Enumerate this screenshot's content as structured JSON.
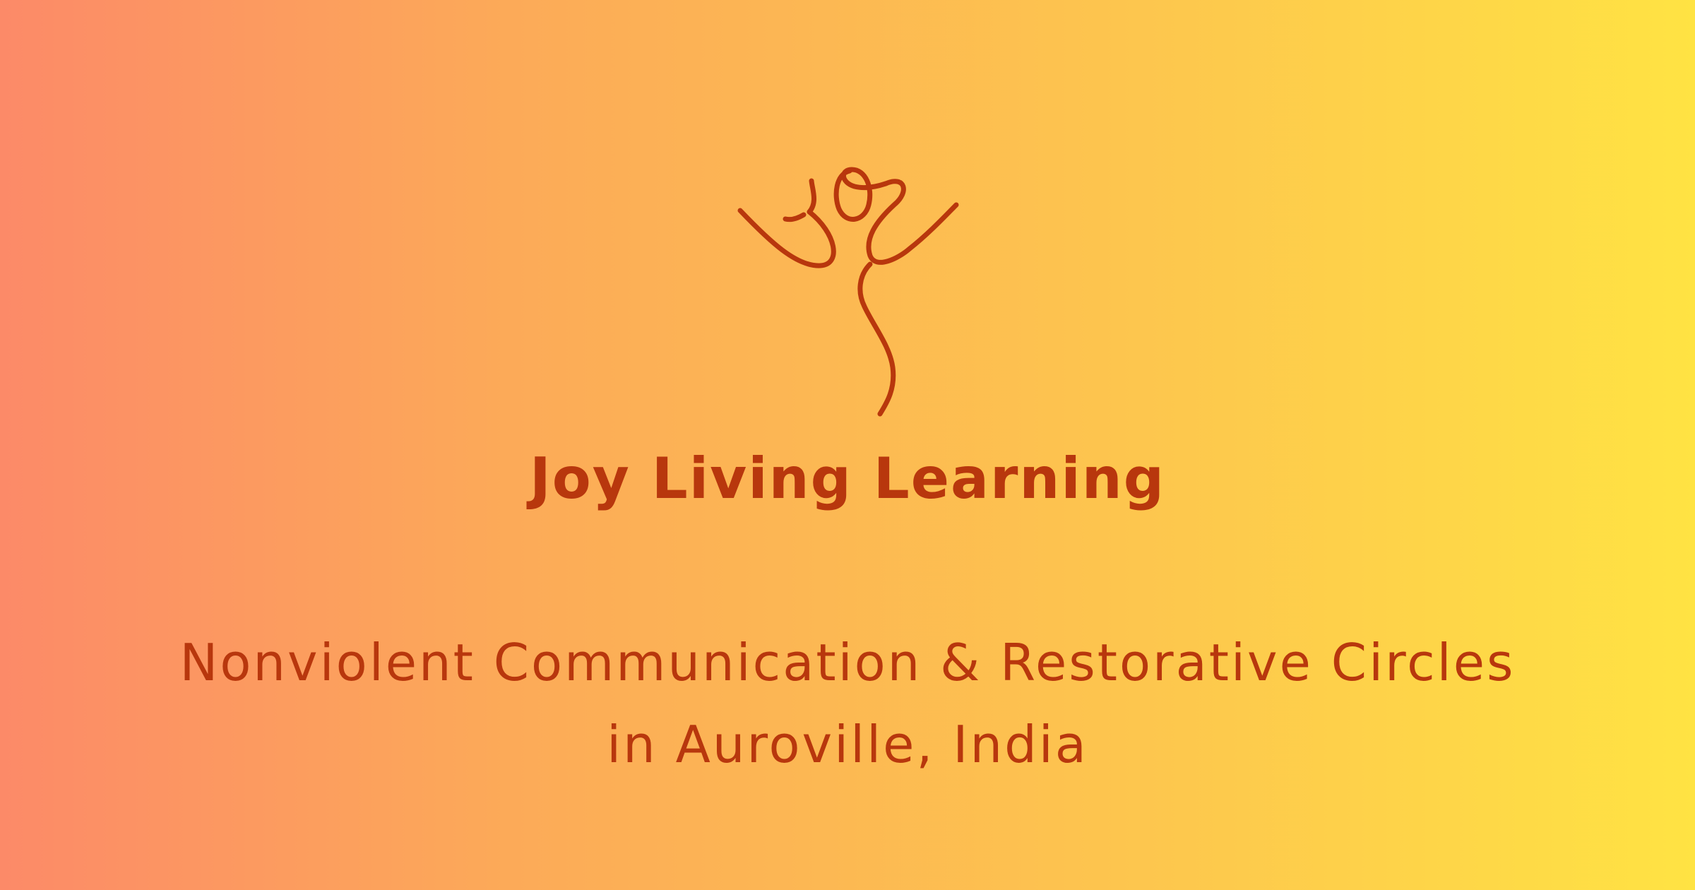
{
  "brand": {
    "name": "Joy Living Learning",
    "logo_icon": "dancing-figure-joy-icon",
    "accent_color": "#b8370d"
  },
  "tagline": {
    "line1": "Nonviolent Communication & Restorative Circles",
    "line2": "in Auroville, India"
  },
  "background": {
    "gradient_start": "#fc8a68",
    "gradient_end": "#ffe343"
  }
}
